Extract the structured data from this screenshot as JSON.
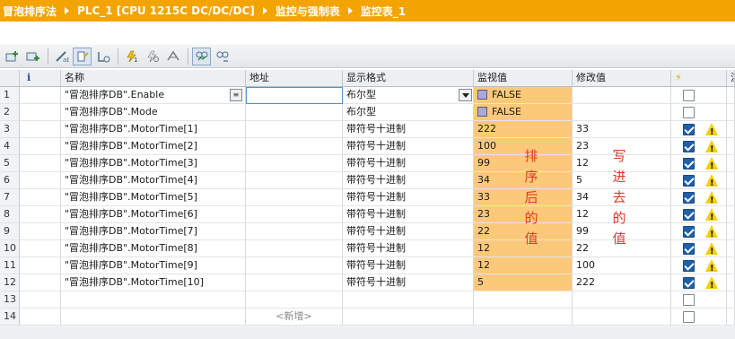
{
  "breadcrumb": [
    "冒泡排序法",
    "PLC_1 [CPU 1215C DC/DC/DC]",
    "监控与强制表",
    "监控表_1"
  ],
  "toolbar": {
    "icons": [
      "insert-row-icon",
      "add-row-icon",
      "rename-icon",
      "monitor-all-icon",
      "monitor-once-icon",
      "modify-now-icon",
      "modify-trigger-icon",
      "enable-periphery-icon",
      "show-columns-icon",
      "advanced-settings-icon"
    ]
  },
  "table": {
    "headers": {
      "num": "",
      "icon": "i",
      "name": "名称",
      "address": "地址",
      "format": "显示格式",
      "monitor": "监视值",
      "modify": "修改值",
      "flag": "⚡",
      "comment": "注"
    },
    "rows": [
      {
        "num": "1",
        "name": "\"冒泡排序DB\".Enable",
        "address": "",
        "format": "布尔型",
        "monitor": "FALSE",
        "modify": "",
        "checked": false,
        "warn": false,
        "bool": true
      },
      {
        "num": "2",
        "name": "\"冒泡排序DB\".Mode",
        "address": "",
        "format": "布尔型",
        "monitor": "FALSE",
        "modify": "",
        "checked": false,
        "warn": false,
        "bool": true
      },
      {
        "num": "3",
        "name": "\"冒泡排序DB\".MotorTime[1]",
        "address": "",
        "format": "带符号十进制",
        "monitor": "222",
        "modify": "33",
        "checked": true,
        "warn": true
      },
      {
        "num": "4",
        "name": "\"冒泡排序DB\".MotorTime[2]",
        "address": "",
        "format": "带符号十进制",
        "monitor": "100",
        "modify": "23",
        "checked": true,
        "warn": true
      },
      {
        "num": "5",
        "name": "\"冒泡排序DB\".MotorTime[3]",
        "address": "",
        "format": "带符号十进制",
        "monitor": "99",
        "modify": "12",
        "checked": true,
        "warn": true
      },
      {
        "num": "6",
        "name": "\"冒泡排序DB\".MotorTime[4]",
        "address": "",
        "format": "带符号十进制",
        "monitor": "34",
        "modify": "5",
        "checked": true,
        "warn": true
      },
      {
        "num": "7",
        "name": "\"冒泡排序DB\".MotorTime[5]",
        "address": "",
        "format": "带符号十进制",
        "monitor": "33",
        "modify": "34",
        "checked": true,
        "warn": true
      },
      {
        "num": "8",
        "name": "\"冒泡排序DB\".MotorTime[6]",
        "address": "",
        "format": "带符号十进制",
        "monitor": "23",
        "modify": "12",
        "checked": true,
        "warn": true
      },
      {
        "num": "9",
        "name": "\"冒泡排序DB\".MotorTime[7]",
        "address": "",
        "format": "带符号十进制",
        "monitor": "22",
        "modify": "99",
        "checked": true,
        "warn": true
      },
      {
        "num": "10",
        "name": "\"冒泡排序DB\".MotorTime[8]",
        "address": "",
        "format": "带符号十进制",
        "monitor": "12",
        "modify": "22",
        "checked": true,
        "warn": true
      },
      {
        "num": "11",
        "name": "\"冒泡排序DB\".MotorTime[9]",
        "address": "",
        "format": "带符号十进制",
        "monitor": "12",
        "modify": "100",
        "checked": true,
        "warn": true
      },
      {
        "num": "12",
        "name": "\"冒泡排序DB\".MotorTime[10]",
        "address": "",
        "format": "带符号十进制",
        "monitor": "5",
        "modify": "222",
        "checked": true,
        "warn": true
      },
      {
        "num": "13",
        "name": "",
        "address": "",
        "format": "",
        "monitor": "",
        "modify": "",
        "checked": false,
        "warn": false,
        "empty": true
      },
      {
        "num": "14",
        "name": "",
        "address": "<新增>",
        "format": "",
        "monitor": "",
        "modify": "",
        "checked": false,
        "warn": false,
        "empty": true
      }
    ]
  },
  "annotations": {
    "sorted": [
      "排",
      "序",
      "后",
      "的",
      "值"
    ],
    "written": [
      "写",
      "进",
      "去",
      "的",
      "值"
    ]
  },
  "colors": {
    "breadcrumb_bg": "#f3a400",
    "monitor_bg": "#fcc97a",
    "annotation": "#e03a2a",
    "checkbox": "#1e5fa8"
  }
}
